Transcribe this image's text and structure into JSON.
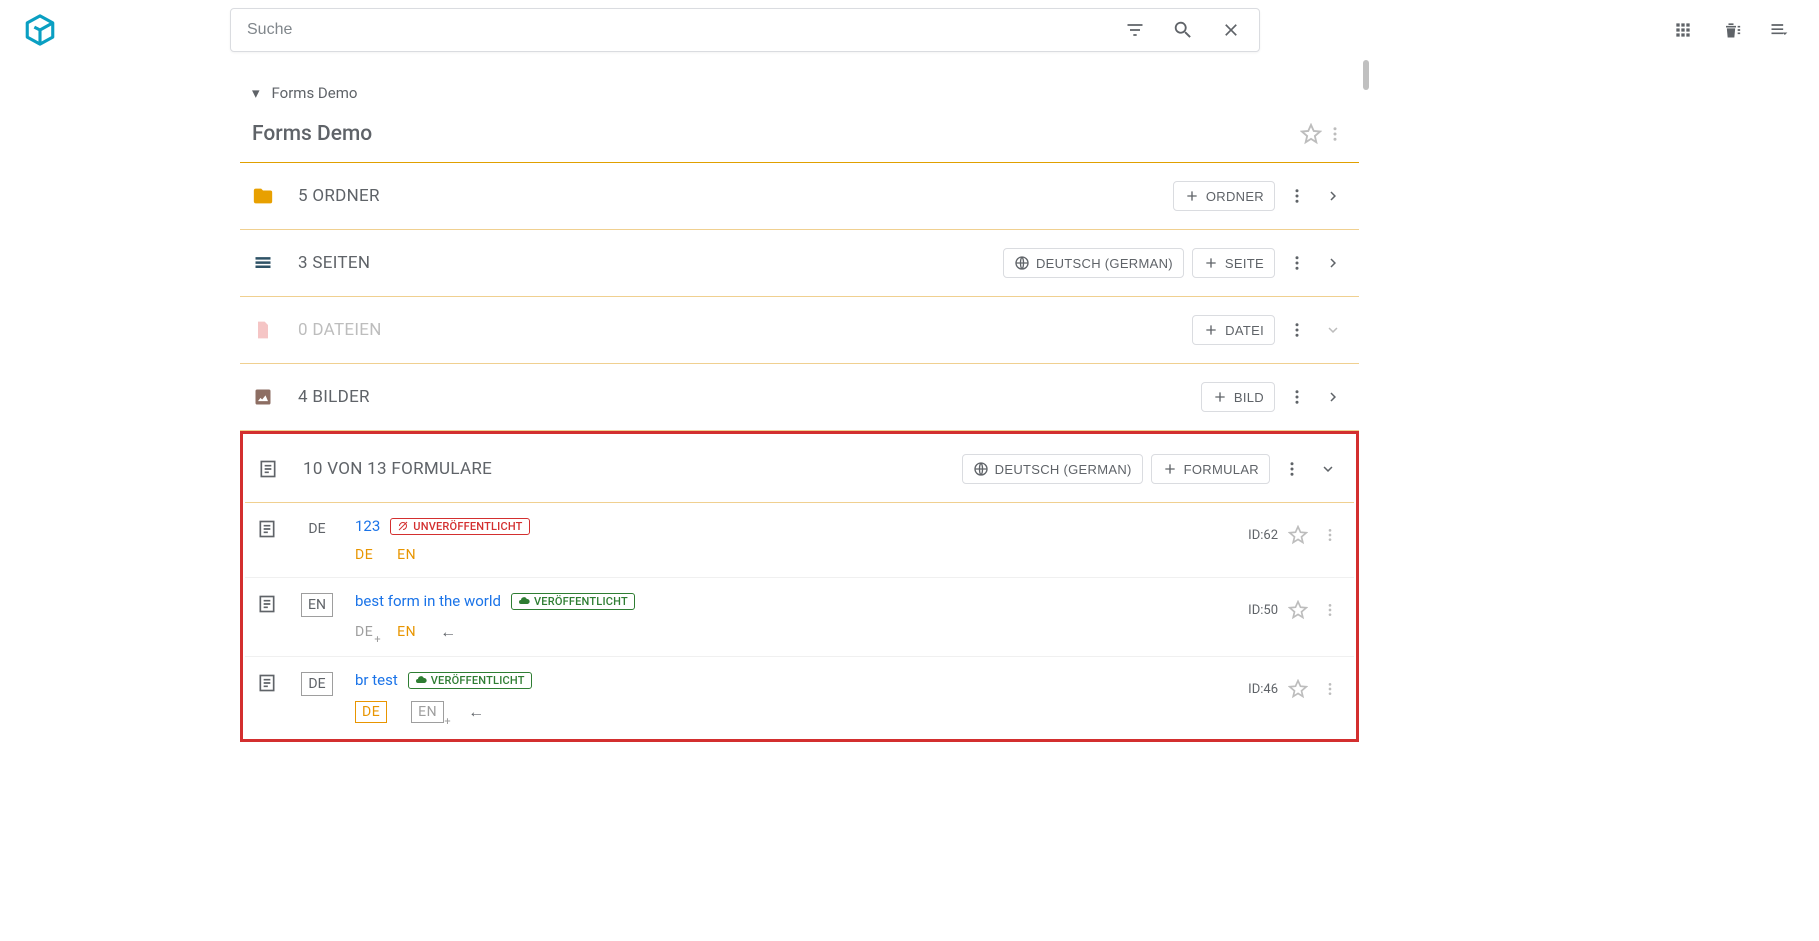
{
  "search": {
    "placeholder": "Suche"
  },
  "breadcrumb": {
    "label": "Forms Demo"
  },
  "page_title": "Forms Demo",
  "sections": {
    "folders": {
      "title": "5 ORDNER",
      "add_label": "ORDNER"
    },
    "pages": {
      "title": "3 SEITEN",
      "lang_label": "DEUTSCH (GERMAN)",
      "add_label": "SEITE"
    },
    "files": {
      "title": "0 DATEIEN",
      "add_label": "DATEI"
    },
    "images": {
      "title": "4 BILDER",
      "add_label": "BILD"
    },
    "forms": {
      "title": "10 VON 13 FORMULARE",
      "lang_label": "DEUTSCH (GERMAN)",
      "add_label": "FORMULAR"
    }
  },
  "status": {
    "unpublished": "UNVERÖFFENTLICHT",
    "published": "VERÖFFENTLICHT"
  },
  "lang": {
    "de": "DE",
    "en": "EN"
  },
  "forms": [
    {
      "lang": "DE",
      "lang_boxed": false,
      "title": "123",
      "published": false,
      "id_label": "ID:62",
      "langs_style": "plain"
    },
    {
      "lang": "EN",
      "lang_boxed": true,
      "title": "best form in the world",
      "published": true,
      "id_label": "ID:50",
      "langs_style": "de_plus_en_orange"
    },
    {
      "lang": "DE",
      "lang_boxed": true,
      "title": "br test",
      "published": true,
      "id_label": "ID:46",
      "langs_style": "de_box_en_box_plus"
    }
  ]
}
